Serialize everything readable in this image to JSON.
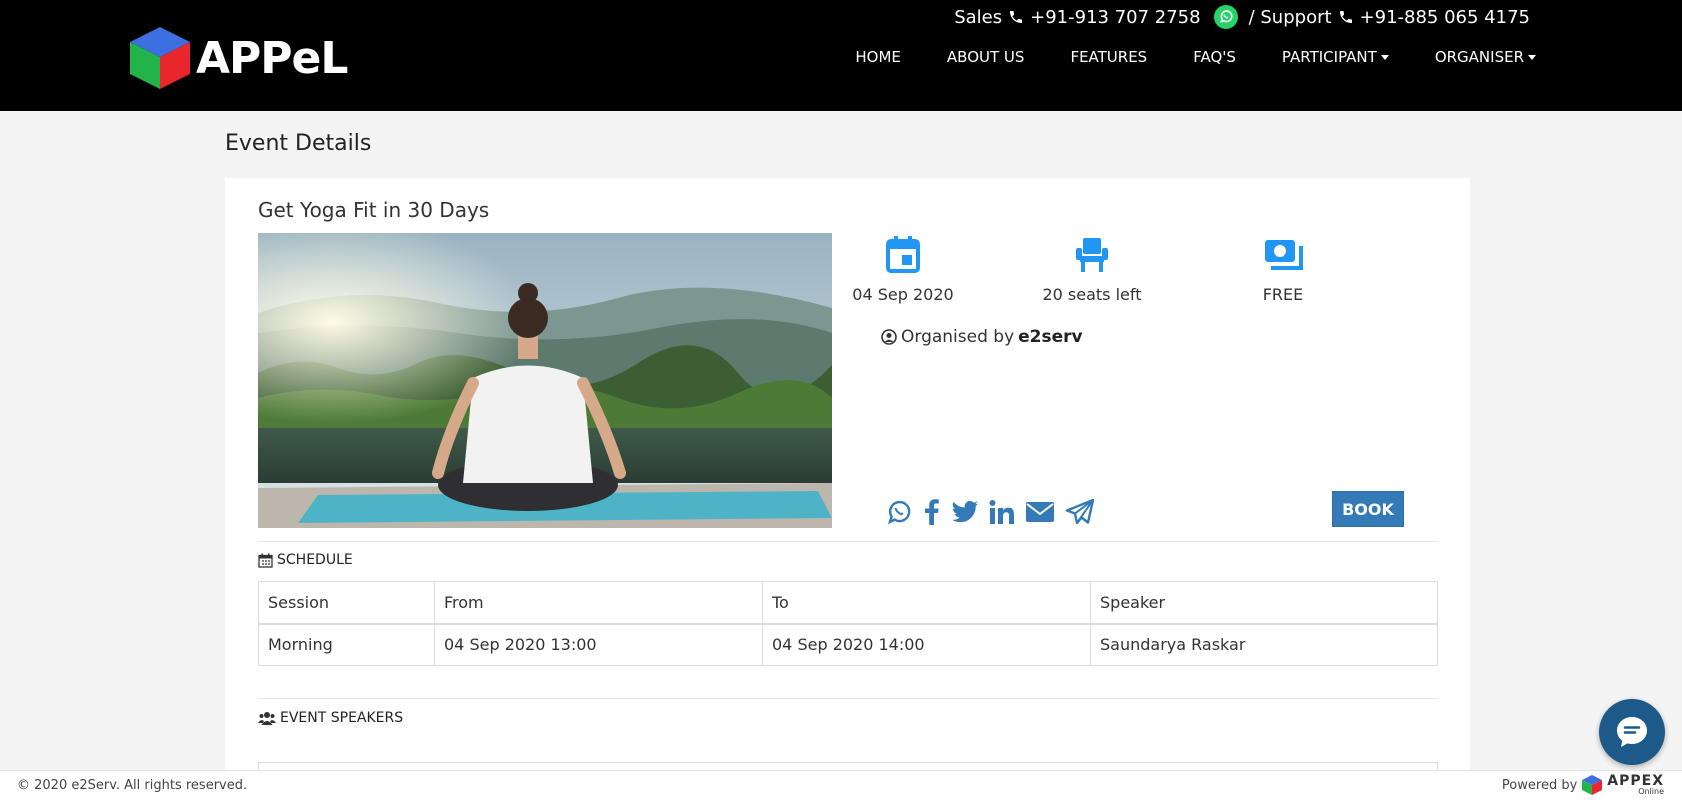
{
  "header": {
    "logo_text": "APPeL",
    "sales_label": "Sales",
    "sales_phone": "+91-913 707 2758",
    "support_label": "/ Support",
    "support_phone": "+91-885 065 4175",
    "nav": [
      {
        "label": "HOME"
      },
      {
        "label": "ABOUT US"
      },
      {
        "label": "FEATURES"
      },
      {
        "label": "FAQ'S"
      },
      {
        "label": "PARTICIPANT"
      },
      {
        "label": "ORGANISER"
      }
    ]
  },
  "page": {
    "title": "Event Details"
  },
  "event": {
    "title": "Get Yoga Fit in 30 Days",
    "date": "04 Sep 2020",
    "seats": "20 seats left",
    "price": "FREE",
    "organised_by_label": "Organised by",
    "organiser": "e2serv",
    "book_label": "BOOK",
    "accent_color": "#2196f3",
    "share_icons": [
      "whatsapp-icon",
      "facebook-icon",
      "twitter-icon",
      "linkedin-icon",
      "envelope-icon",
      "telegram-icon"
    ]
  },
  "schedule": {
    "heading": "SCHEDULE",
    "columns": [
      "Session",
      "From",
      "To",
      "Speaker"
    ],
    "rows": [
      [
        "Morning",
        "04 Sep 2020 13:00",
        "04 Sep 2020 14:00",
        "Saundarya Raskar"
      ]
    ]
  },
  "speakers": {
    "heading": "EVENT SPEAKERS"
  },
  "footer": {
    "copyright": "© 2020 e2Serv. All rights reserved.",
    "powered_by": "Powered by",
    "brand": "APPEX",
    "brand_sub": "Online"
  }
}
